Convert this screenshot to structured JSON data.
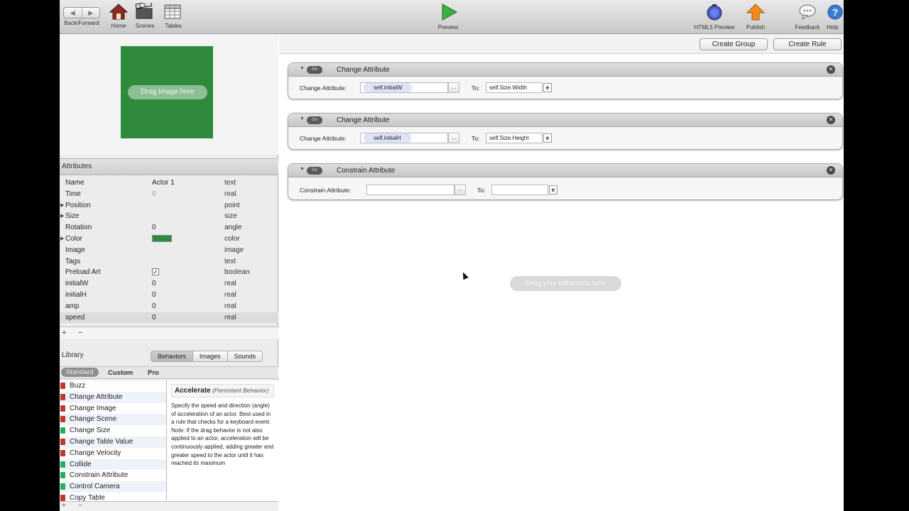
{
  "toolbar": {
    "back_forward": "Back/Forward",
    "home": "Home",
    "scenes": "Scenes",
    "tables": "Tables",
    "preview": "Preview",
    "html5_preview": "HTML5 Preview",
    "publish": "Publish",
    "feedback": "Feedback",
    "help": "Help"
  },
  "preview_panel": {
    "drag_image": "Drag Image here",
    "actor_color": "#2f8a3e"
  },
  "attributes": {
    "header": "Attributes",
    "rows": [
      {
        "name": "Name",
        "value": "Actor 1",
        "type": "text"
      },
      {
        "name": "Time",
        "value": "0",
        "type": "real"
      },
      {
        "name": "Position",
        "value": "",
        "type": "point"
      },
      {
        "name": "Size",
        "value": "",
        "type": "size"
      },
      {
        "name": "Rotation",
        "value": "0",
        "type": "angle"
      },
      {
        "name": "Color",
        "value": "",
        "type": "color"
      },
      {
        "name": "Image",
        "value": "",
        "type": "image"
      },
      {
        "name": "Tags",
        "value": "",
        "type": "text"
      },
      {
        "name": "Preload Art",
        "value": "",
        "type": "boolean"
      },
      {
        "name": "initialW",
        "value": "0",
        "type": "real"
      },
      {
        "name": "initialH",
        "value": "0",
        "type": "real"
      },
      {
        "name": "amp",
        "value": "0",
        "type": "real"
      },
      {
        "name": "speed",
        "value": "0",
        "type": "real"
      }
    ],
    "add": "+",
    "remove": "−"
  },
  "library": {
    "title": "Library",
    "tabs": [
      "Behaviors",
      "Images",
      "Sounds"
    ],
    "subtabs": [
      "Standard",
      "Custom",
      "Pro"
    ],
    "items": [
      {
        "label": "Buzz",
        "color": "#c0392b"
      },
      {
        "label": "Change Attribute",
        "color": "#c0392b"
      },
      {
        "label": "Change Image",
        "color": "#c0392b"
      },
      {
        "label": "Change Scene",
        "color": "#c0392b"
      },
      {
        "label": "Change Size",
        "color": "#27ae60"
      },
      {
        "label": "Change Table Value",
        "color": "#c0392b"
      },
      {
        "label": "Change Velocity",
        "color": "#c0392b"
      },
      {
        "label": "Collide",
        "color": "#27ae60"
      },
      {
        "label": "Constrain Attribute",
        "color": "#27ae60"
      },
      {
        "label": "Control Camera",
        "color": "#27ae60"
      },
      {
        "label": "Copy Table",
        "color": "#c0392b"
      }
    ],
    "desc_title": "Accelerate",
    "desc_subtitle": "(Persistent Behavior)",
    "desc_body": "Specify the speed and direction (angle) of acceleration of an actor. Best used in a rule that checks for a keyboard event. Note: If the drag behavior is not also applied to an actor, acceleration will be continuously applied, adding greater and greater speed to the actor until it has reached its maximum"
  },
  "rules": {
    "create_group": "Create Group",
    "create_rule": "Create Rule",
    "behaviors": [
      {
        "title": "Change Attribute",
        "label": "Change Attribute:",
        "attr": "self.initialW",
        "to_label": "To:",
        "to_value": "self.Size.Width"
      },
      {
        "title": "Change Attribute",
        "label": "Change Attribute:",
        "attr": "self.initialH",
        "to_label": "To:",
        "to_value": "self.Size.Height"
      },
      {
        "title": "Constrain Attribute",
        "label": "Constrain Attribute:",
        "attr": "",
        "to_label": "To:",
        "to_value": ""
      }
    ],
    "on_label": "On",
    "drag_behaviors": "Drag your behaviors here"
  }
}
